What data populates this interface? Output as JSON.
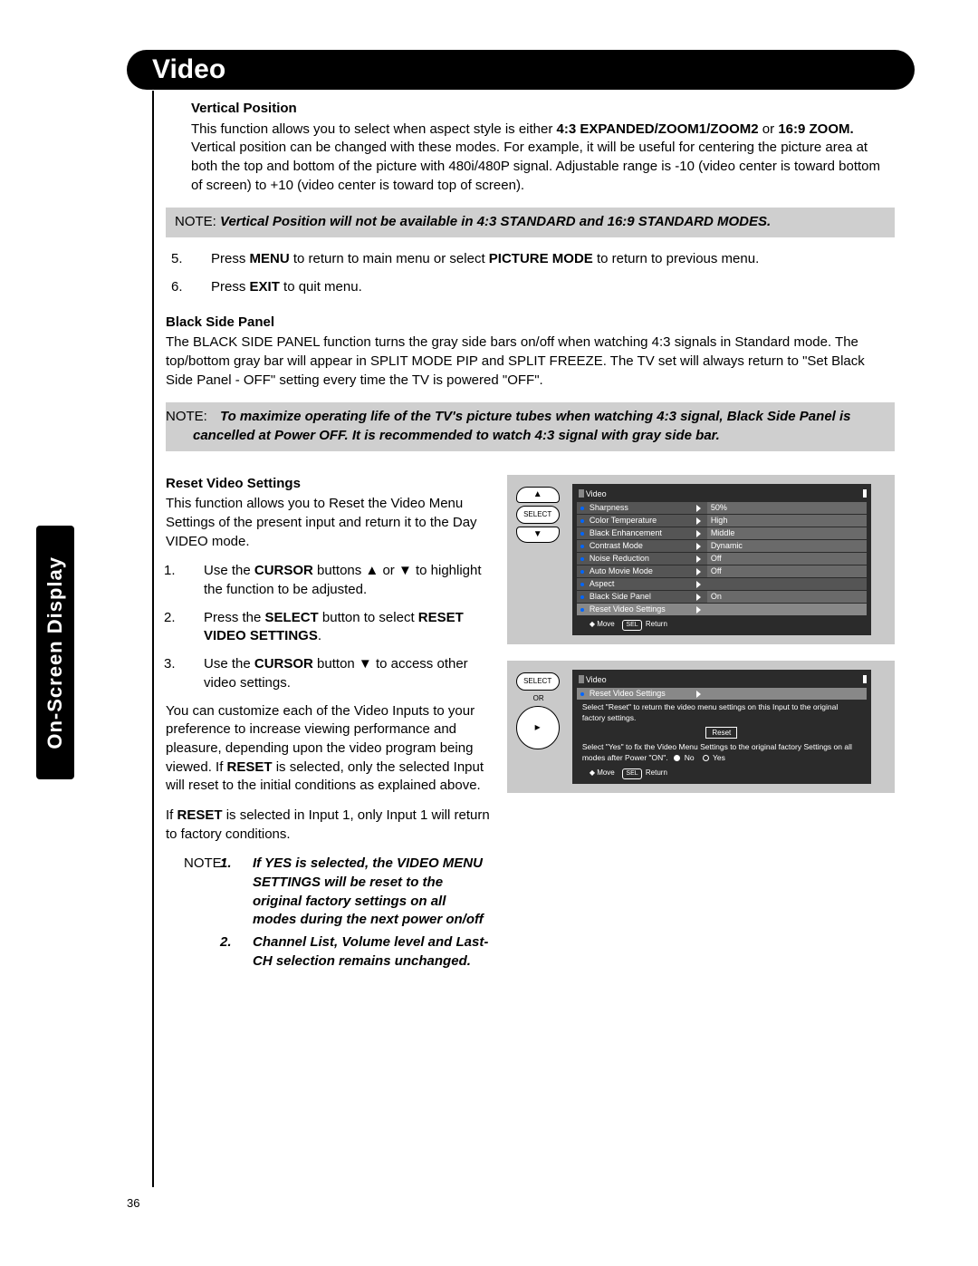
{
  "side_tab": "On-Screen Display",
  "header": "Video",
  "page_number": "36",
  "vertical_position": {
    "heading": "Vertical Position",
    "body_pre": "This function allows you to select when aspect style is either ",
    "body_bold1": "4:3 EXPANDED/ZOOM1/ZOOM2",
    "body_mid1": " or ",
    "body_bold2": "16:9 ZOOM.",
    "body_post": " Vertical position can be changed with these modes. For example, it will be useful for centering the picture area at both the top and bottom of the picture with 480i/480P signal. Adjustable range is -10 (video center is toward bottom of screen) to +10 (video center is toward top of screen).",
    "note_label": "NOTE:  ",
    "note_text": "Vertical Position will not be available in 4:3 STANDARD and 16:9 STANDARD MODES."
  },
  "steps_a": {
    "s5_pre": "Press ",
    "s5_b1": "MENU",
    "s5_mid": " to return to main menu or select ",
    "s5_b2": "PICTURE MODE",
    "s5_post": " to return to previous menu.",
    "s6_pre": "Press ",
    "s6_b1": "EXIT",
    "s6_post": " to quit menu."
  },
  "black_side_panel": {
    "heading": "Black Side Panel",
    "body": "The BLACK SIDE PANEL function turns the gray side bars on/off when watching 4:3 signals in Standard mode. The top/bottom gray bar will appear in SPLIT MODE PIP and SPLIT FREEZE. The TV set will always return to \"Set Black Side Panel - OFF\" setting every time the TV is powered \"OFF\".",
    "note_label": "NOTE:  ",
    "note_text": "To maximize operating life of the TV's picture tubes when watching 4:3 signal, Black Side Panel is cancelled at Power OFF. It is recommended to watch 4:3 signal with gray side bar."
  },
  "reset_video": {
    "heading": "Reset Video Settings",
    "intro": "This function allows you to Reset the Video Menu Settings of the present input and return it to the Day VIDEO mode.",
    "s1_pre": "Use the ",
    "s1_b": "CURSOR",
    "s1_post": " buttons ▲ or ▼ to highlight the function to be adjusted.",
    "s2_pre": "Press the ",
    "s2_b1": "SELECT",
    "s2_mid": " button to select ",
    "s2_b2": "RESET VIDEO SETTINGS",
    "s2_post": ".",
    "s3_pre": "Use the ",
    "s3_b": "CURSOR",
    "s3_post": " button ▼ to access other video settings.",
    "p1_pre": "You can customize each of the Video Inputs to your preference to increase viewing performance and pleasure, depending upon the video program being viewed. If ",
    "p1_b": "RESET",
    "p1_post": " is selected, only the selected Input will reset to the initial conditions as explained above.",
    "p2_pre": "If ",
    "p2_b": "RESET",
    "p2_post": " is selected in Input 1, only Input 1 will return to factory conditions.",
    "note_label": "NOTE:  ",
    "note1": "If YES is selected, the VIDEO MENU SETTINGS will be reset to the original factory settings on all modes during the next power on/off",
    "note2": "Channel List, Volume level and Last-CH selection remains unchanged."
  },
  "osd1": {
    "select_label": "SELECT",
    "title": "Video",
    "rows": [
      {
        "label": "Sharpness",
        "value": "50%"
      },
      {
        "label": "Color Temperature",
        "value": "High"
      },
      {
        "label": "Black Enhancement",
        "value": "Middle"
      },
      {
        "label": "Contrast Mode",
        "value": "Dynamic"
      },
      {
        "label": "Noise Reduction",
        "value": "Off"
      },
      {
        "label": "Auto Movie Mode",
        "value": "Off"
      },
      {
        "label": "Aspect",
        "value": ""
      },
      {
        "label": "Black Side Panel",
        "value": "On"
      },
      {
        "label": "Reset Video Settings",
        "value": ""
      }
    ],
    "foot_move": "Move",
    "foot_sel": "SEL",
    "foot_return": "Return"
  },
  "osd2": {
    "select_label": "SELECT",
    "or_label": "OR",
    "title": "Video",
    "sub": "Reset Video Settings",
    "line1": "Select \"Reset\" to return the video menu settings on this Input to the original factory settings.",
    "reset_btn": "Reset",
    "line2": "Select \"Yes\" to fix the Video Menu Settings to the original factory Settings on all modes after Power \"ON\".",
    "no": "No",
    "yes": "Yes",
    "foot_move": "Move",
    "foot_sel": "SEL",
    "foot_return": "Return"
  }
}
